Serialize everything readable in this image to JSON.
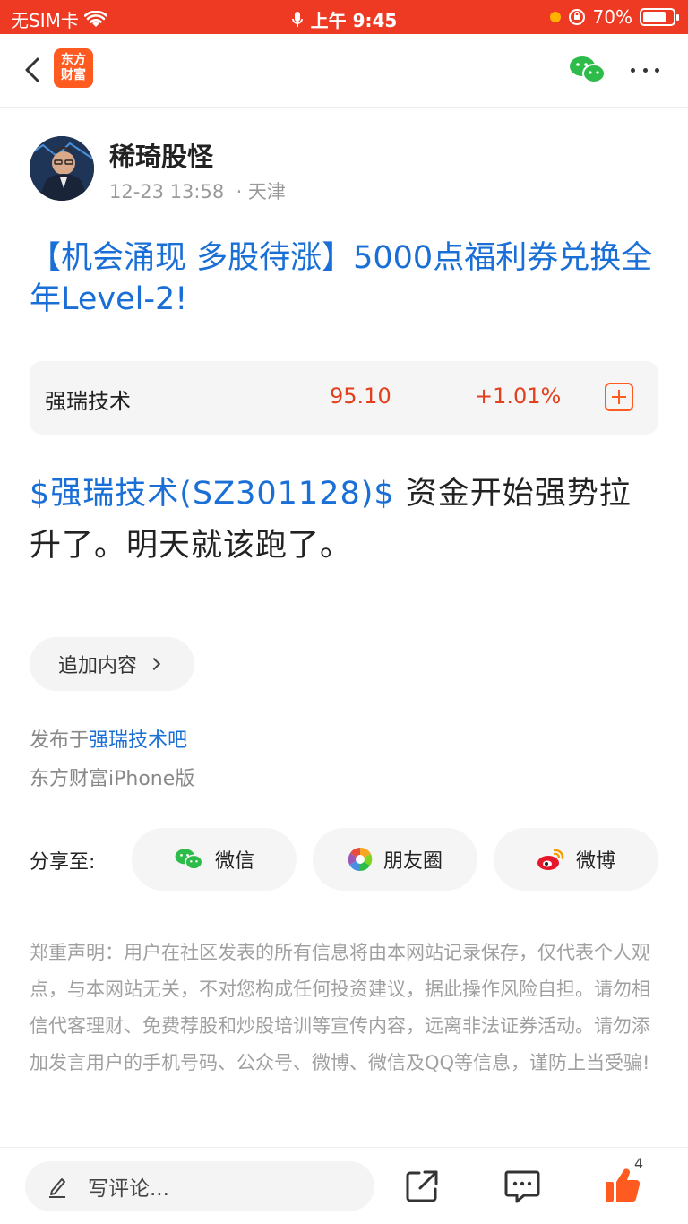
{
  "status_bar": {
    "carrier": "无SIM卡",
    "time": "上午 9:45",
    "battery": "70%",
    "battery_level": 0.7
  },
  "nav": {
    "logo_text_line1": "东方",
    "logo_text_line2": "财富",
    "icons": [
      "back-icon",
      "wechat-icon",
      "more-icon"
    ]
  },
  "author": {
    "name": "稀琦股怪",
    "time": "12-23 13:58",
    "location": "· 天津"
  },
  "post": {
    "title": "【机会涌现 多股待涨】5000点福利券兑换全年Level-2!",
    "body_link": "$强瑞技术(SZ301128)$",
    "body_text": " 资金开始强势拉升了。明天就该跑了。"
  },
  "stock_card": {
    "name": "强瑞技术",
    "price": "95.10",
    "change": "+1.01%",
    "change_color": "#e2401d"
  },
  "append_button": "追加内容",
  "published": {
    "prefix": "发布于",
    "bar": "强瑞技术吧",
    "client": "东方财富iPhone版"
  },
  "share": {
    "label": "分享至:",
    "wechat": "微信",
    "moments": "朋友圈",
    "weibo": "微博"
  },
  "disclaimer": "郑重声明：用户在社区发表的所有信息将由本网站记录保存，仅代表个人观点，与本网站无关，不对您构成任何投资建议，据此操作风险自担。请勿相信代客理财、免费荐股和炒股培训等宣传内容，远离非法证券活动。请勿添加发言用户的手机号码、公众号、微博、微信及QQ等信息，谨防上当受骗!",
  "bottom_bar": {
    "comment_placeholder": "写评论...",
    "like_count": "4"
  },
  "colors": {
    "accent": "#ee3a22",
    "link": "#1a6fd6",
    "brand_orange": "#ff5a1f"
  }
}
